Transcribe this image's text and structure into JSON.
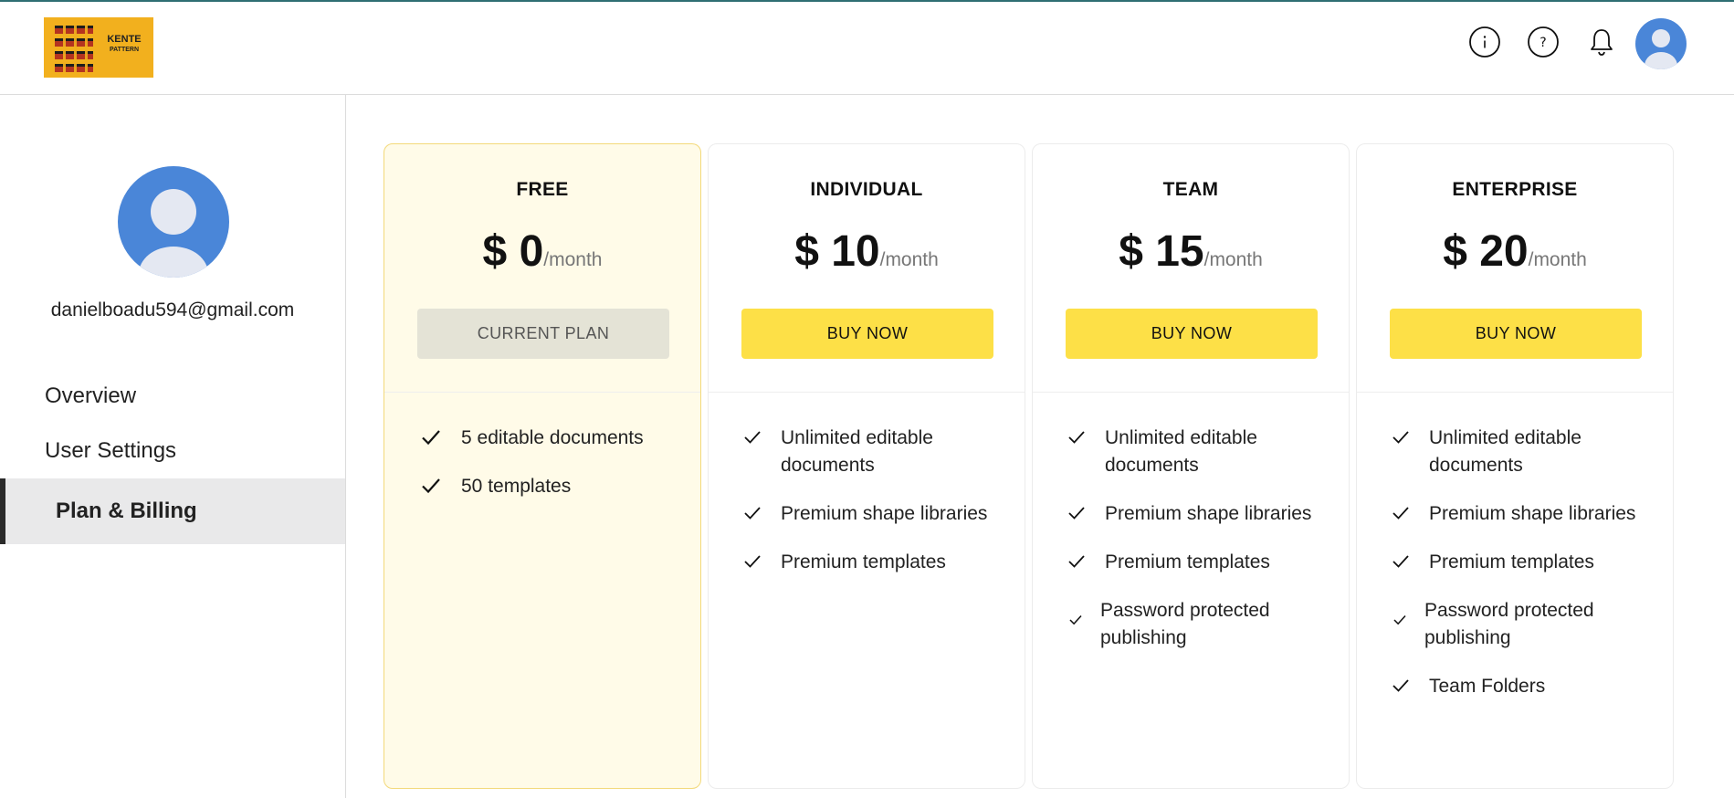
{
  "logo": {
    "title": "KENTE",
    "subtitle": "PATTERN"
  },
  "header": {
    "icons": [
      "info-icon",
      "help-icon",
      "bell-icon",
      "user-avatar"
    ]
  },
  "sidebar": {
    "email": "danielboadu594@gmail.com",
    "items": [
      {
        "label": "Overview",
        "active": false
      },
      {
        "label": "User Settings",
        "active": false
      },
      {
        "label": "Plan & Billing",
        "active": true
      }
    ]
  },
  "plans": [
    {
      "name": "FREE",
      "price": "$ 0",
      "period": "/month",
      "button": "CURRENT PLAN",
      "current": true,
      "features": [
        "5 editable documents",
        "50 templates"
      ]
    },
    {
      "name": "INDIVIDUAL",
      "price": "$ 10",
      "period": "/month",
      "button": "BUY NOW",
      "current": false,
      "features": [
        "Unlimited editable documents",
        "Premium shape libraries",
        "Premium templates"
      ]
    },
    {
      "name": "TEAM",
      "price": "$ 15",
      "period": "/month",
      "button": "BUY NOW",
      "current": false,
      "features": [
        "Unlimited editable documents",
        "Premium shape libraries",
        "Premium templates",
        "Password protected publishing"
      ]
    },
    {
      "name": "ENTERPRISE",
      "price": "$ 20",
      "period": "/month",
      "button": "BUY NOW",
      "current": false,
      "features": [
        "Unlimited editable documents",
        "Premium shape libraries",
        "Premium templates",
        "Password protected publishing",
        "Team Folders"
      ]
    }
  ],
  "colors": {
    "accent": "#fde047",
    "current_card_bg": "#fffbe8",
    "avatar_blue": "#4a86d8"
  }
}
